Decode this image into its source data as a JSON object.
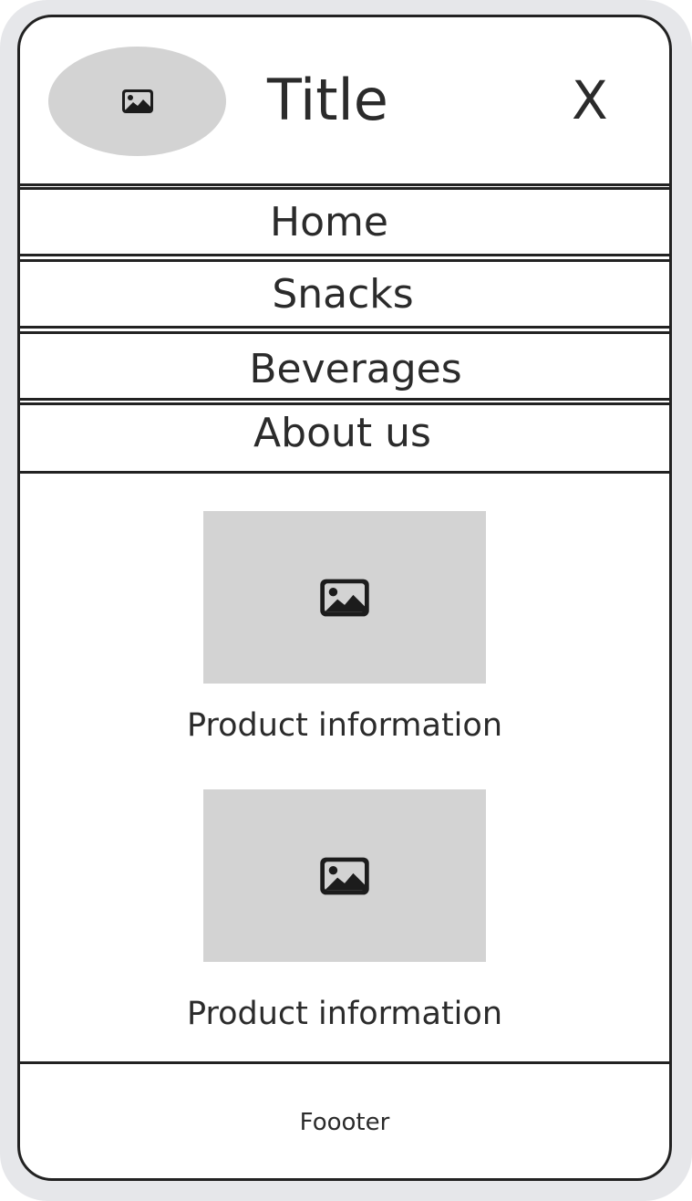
{
  "header": {
    "logo_icon": "image-icon",
    "title": "Title",
    "close_label": "X"
  },
  "nav": {
    "items": [
      {
        "label": "Home"
      },
      {
        "label": "Snacks"
      },
      {
        "label": "Beverages"
      },
      {
        "label": "About us"
      }
    ]
  },
  "products": [
    {
      "image_icon": "image-icon",
      "info": "Product information"
    },
    {
      "image_icon": "image-icon",
      "info": "Product information"
    }
  ],
  "footer": {
    "text": "Foooter"
  },
  "colors": {
    "placeholder_gray": "#d3d3d3",
    "border": "#222222",
    "device_frame": "#e6e7ea",
    "text": "#2b2b2b"
  }
}
